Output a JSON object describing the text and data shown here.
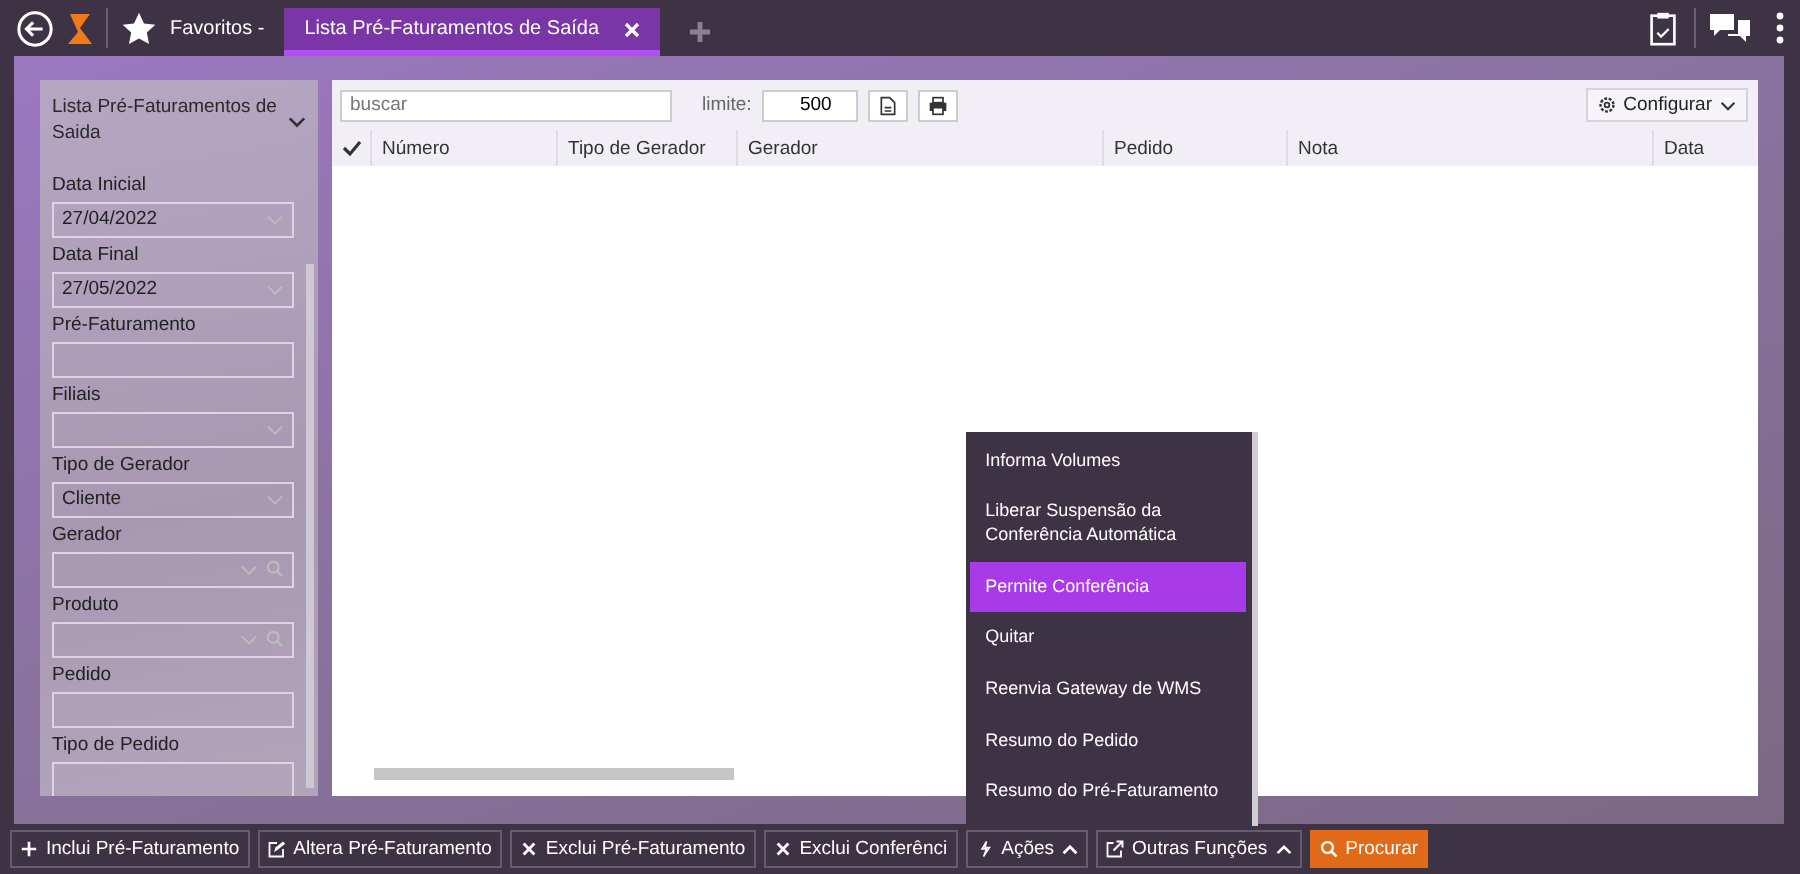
{
  "topbar": {
    "favorites": "Favoritos -",
    "tabs": [
      {
        "label": "Lista Pré-Faturamentos de Saída",
        "selected": true
      }
    ]
  },
  "filters": {
    "title": "Lista Pré-Faturamentos de Saida",
    "fields": [
      {
        "label": "Data Inicial",
        "kind": "select",
        "value": "27/04/2022"
      },
      {
        "label": "Data Final",
        "kind": "select",
        "value": "27/05/2022"
      },
      {
        "label": "Pré-Faturamento",
        "kind": "text"
      },
      {
        "label": "Filiais",
        "kind": "select"
      },
      {
        "label": "Tipo de Gerador",
        "kind": "select",
        "value": "Cliente"
      },
      {
        "label": "Gerador",
        "kind": "lookup"
      },
      {
        "label": "Produto",
        "kind": "lookup"
      },
      {
        "label": "Pedido",
        "kind": "text"
      },
      {
        "label": "Tipo de Pedido",
        "kind": "text"
      }
    ]
  },
  "grid": {
    "search": {
      "placeholder": "buscar"
    },
    "limit_label": "limite:",
    "limit": "500",
    "configure": "Configurar",
    "columns": [
      "Número",
      "Tipo de Gerador",
      "Gerador",
      "Pedido",
      "Nota",
      "Data"
    ]
  },
  "menu": {
    "items": [
      {
        "label": "Informa Volumes",
        "selected": false
      },
      {
        "label": "Liberar Suspensão da Conferência Automática",
        "selected": false
      },
      {
        "label": "Permite Conferência",
        "selected": true
      },
      {
        "label": "Quitar",
        "selected": false
      },
      {
        "label": "Reenvia Gateway de WMS",
        "selected": false
      },
      {
        "label": "Resumo do Pedido",
        "selected": false
      },
      {
        "label": "Resumo do Pré-Faturamento",
        "selected": false
      }
    ]
  },
  "buttons": [
    {
      "label": "Inclui Pré-Faturamento",
      "kind": "add"
    },
    {
      "label": "Altera Pré-Faturamento",
      "kind": "edit"
    },
    {
      "label": "Exclui Pré-Faturamento",
      "kind": "remove"
    },
    {
      "label": "Exclui Conferênci",
      "kind": "remove"
    },
    {
      "label": "Ações",
      "kind": "actions",
      "expanded": true
    },
    {
      "label": "Outras Funções",
      "kind": "functions",
      "expanded": false
    },
    {
      "label": "Procurar",
      "kind": "search"
    }
  ]
}
